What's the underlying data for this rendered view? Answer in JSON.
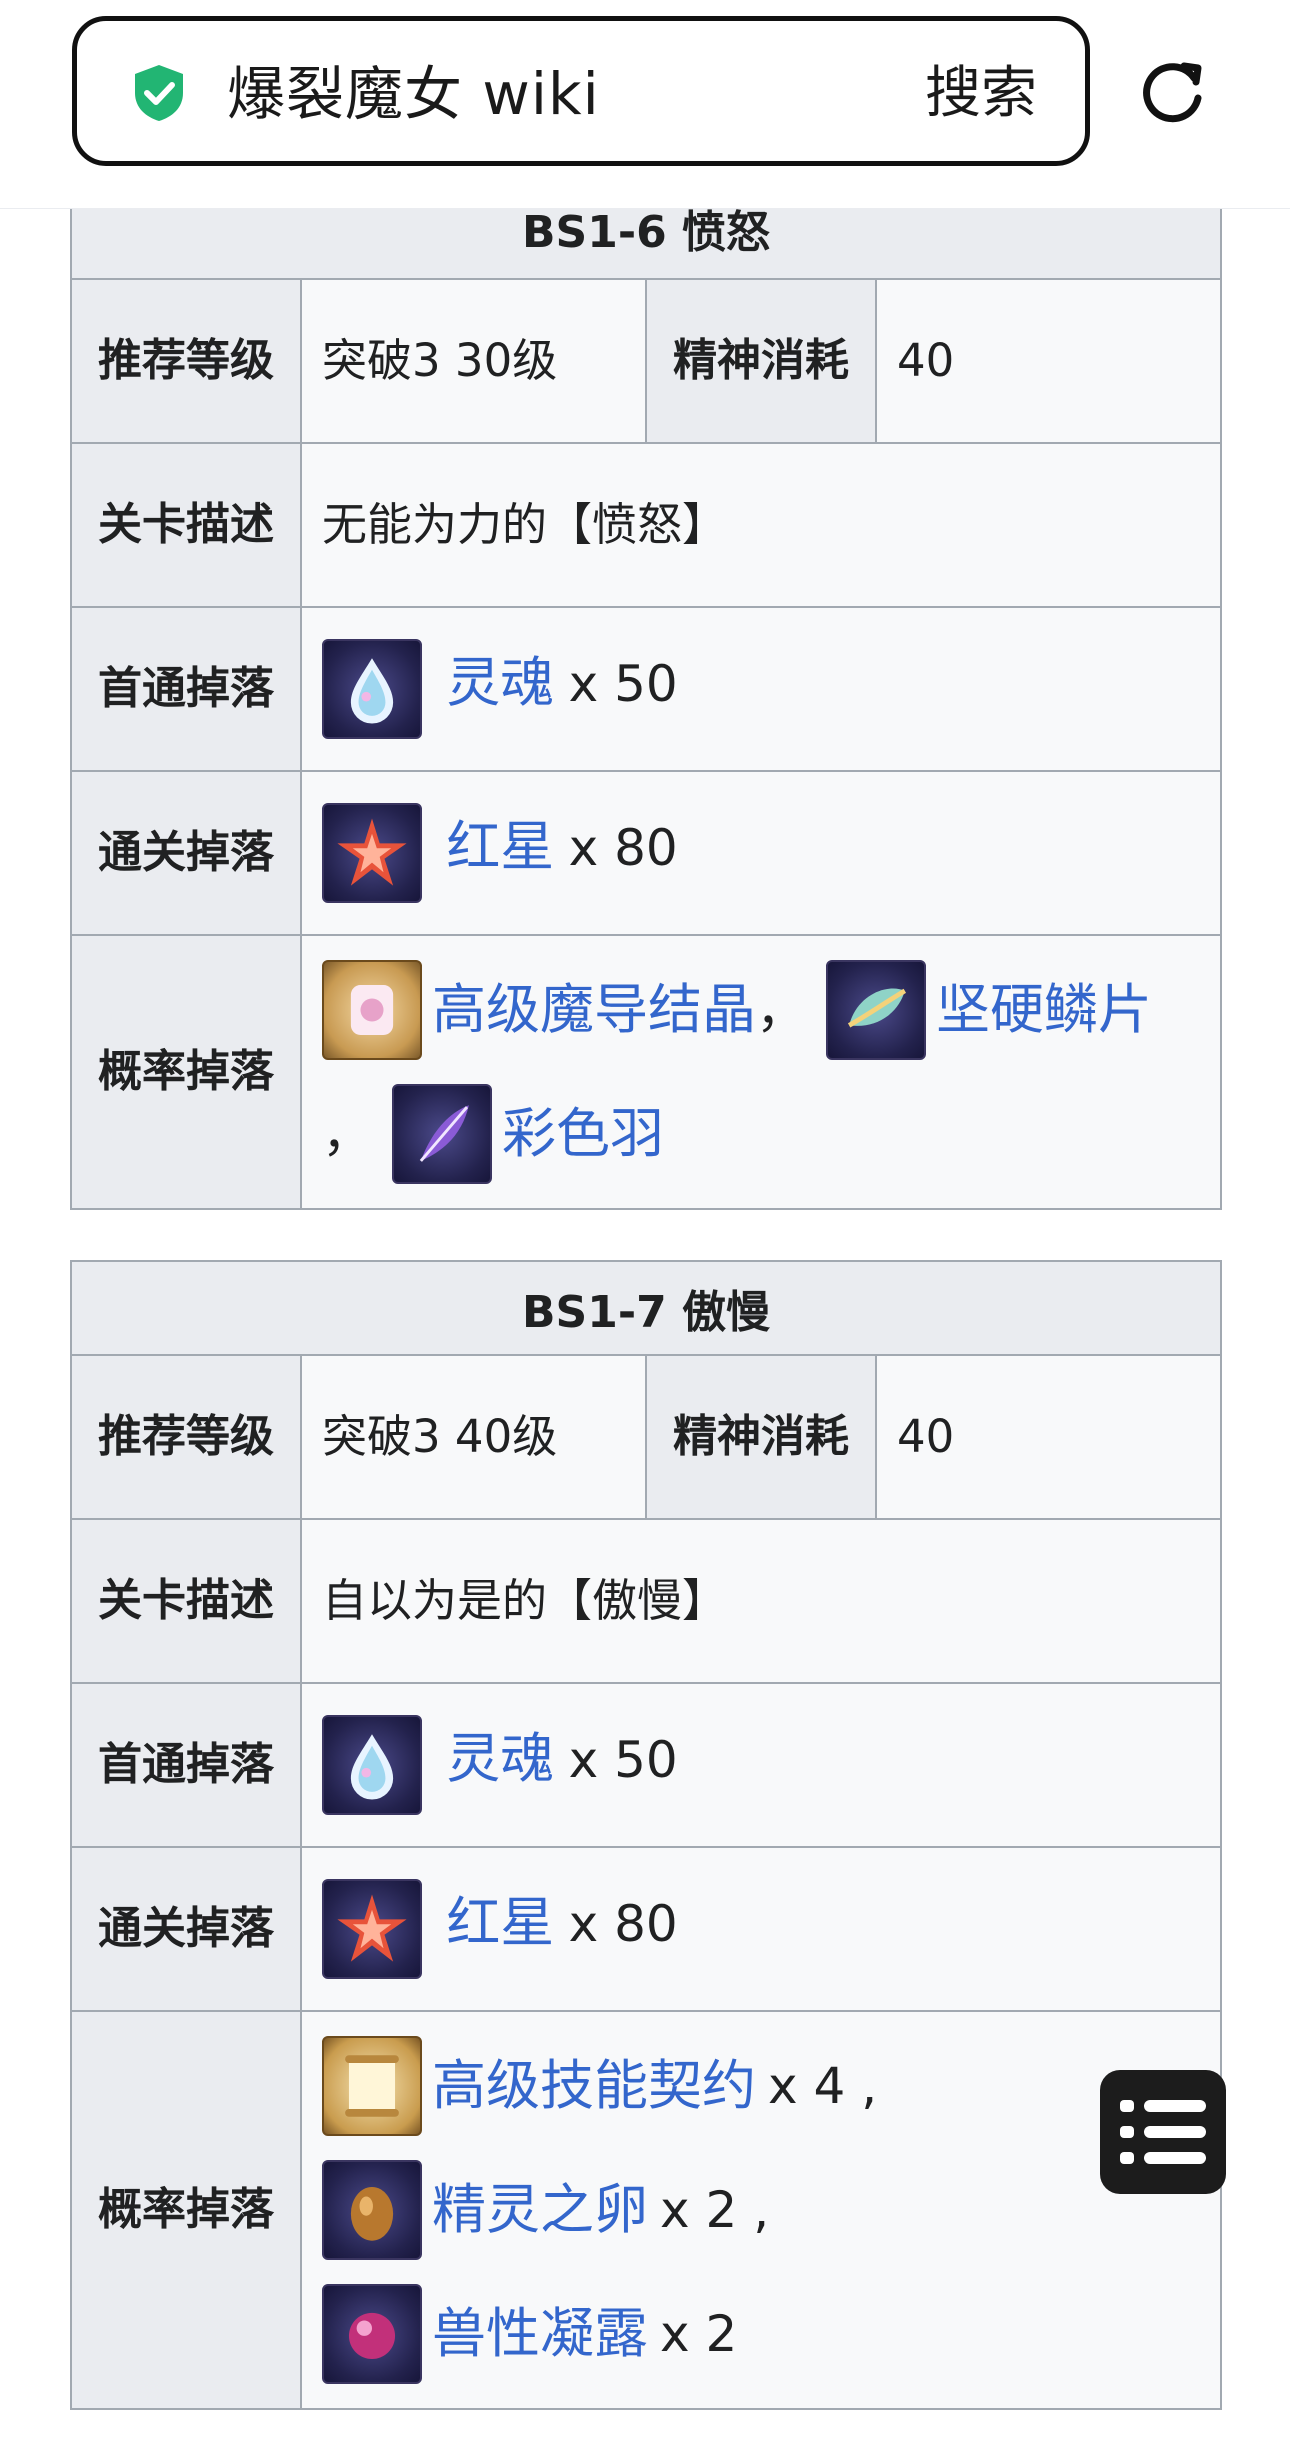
{
  "search": {
    "title": "爆裂魔女 wiki",
    "button": "搜索"
  },
  "tables": [
    {
      "caption": "BS1-6 愤怒",
      "level_label": "推荐等级",
      "level": "突破3 30级",
      "stamina_label": "精神消耗",
      "stamina": "40",
      "desc_label": "关卡描述",
      "desc": "无能为力的【愤怒】",
      "first_label": "首通掉落",
      "first_item": "灵魂",
      "first_qty": "x 50",
      "clear_label": "通关掉落",
      "clear_item": "红星",
      "clear_qty": "x 80",
      "prob_label": "概率掉落",
      "prob_items": [
        "高级魔导结晶",
        "坚硬鳞片",
        "彩色羽"
      ],
      "sep": "，"
    },
    {
      "caption": "BS1-7 傲慢",
      "level_label": "推荐等级",
      "level": "突破3 40级",
      "stamina_label": "精神消耗",
      "stamina": "40",
      "desc_label": "关卡描述",
      "desc": "自以为是的【傲慢】",
      "first_label": "首通掉落",
      "first_item": "灵魂",
      "first_qty": "x 50",
      "clear_label": "通关掉落",
      "clear_item": "红星",
      "clear_qty": "x 80",
      "prob_label": "概率掉落",
      "prob_items": [
        {
          "name": "高级技能契约",
          "qty": "x 4 ,"
        },
        {
          "name": "精灵之卵",
          "qty": "x 2 ,"
        },
        {
          "name": "兽性凝露",
          "qty": "x 2"
        }
      ]
    }
  ],
  "colors": {
    "link": "#3366cc",
    "header_bg": "#eaecf0",
    "cell_bg": "#f8f9fa",
    "border": "#a2a9b1",
    "shield": "#22b573"
  },
  "icons": {
    "secure": "shield-check-icon",
    "reload": "reload-icon",
    "menu": "list-menu-icon"
  }
}
